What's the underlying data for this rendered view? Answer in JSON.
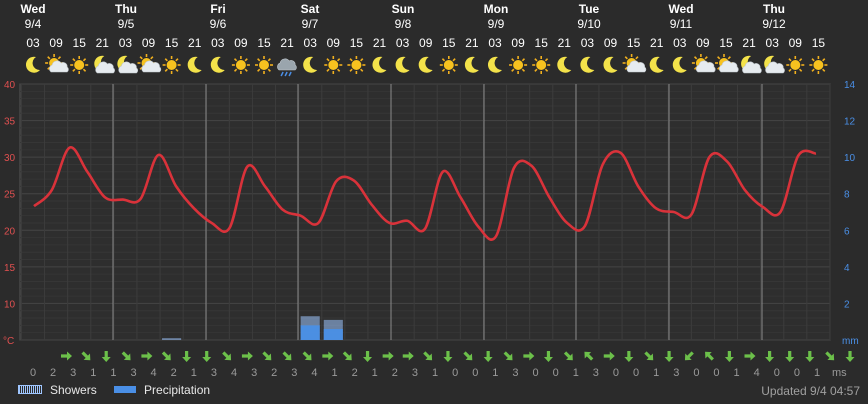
{
  "chart_data": {
    "type": "line",
    "days": [
      {
        "name": "Wed",
        "date": "9/4"
      },
      {
        "name": "Thu",
        "date": "9/5"
      },
      {
        "name": "Fri",
        "date": "9/6"
      },
      {
        "name": "Sat",
        "date": "9/7"
      },
      {
        "name": "Sun",
        "date": "9/8"
      },
      {
        "name": "Mon",
        "date": "9/9"
      },
      {
        "name": "Tue",
        "date": "9/10"
      },
      {
        "name": "Wed",
        "date": "9/11"
      },
      {
        "name": "Thu",
        "date": "9/12"
      }
    ],
    "hours": [
      "03",
      "09",
      "15",
      "21",
      "03",
      "09",
      "15",
      "21",
      "03",
      "09",
      "15",
      "21",
      "03",
      "09",
      "15",
      "21",
      "03",
      "09",
      "15",
      "21",
      "03",
      "09",
      "15",
      "21",
      "03",
      "09",
      "15",
      "21",
      "03",
      "09",
      "15",
      "21",
      "03",
      "09",
      "15"
    ],
    "icons": [
      "moon-icon",
      "sun-cloud-icon",
      "sun-icon",
      "moon-cloud-icon",
      "moon-cloud-icon",
      "sun-cloud-icon",
      "sun-icon",
      "moon-icon",
      "moon-icon",
      "sun-icon",
      "sun-icon",
      "rain-cloud-icon",
      "moon-icon",
      "sun-icon",
      "sun-icon",
      "moon-icon",
      "moon-icon",
      "moon-icon",
      "sun-icon",
      "moon-icon",
      "moon-icon",
      "sun-icon",
      "sun-icon",
      "moon-icon",
      "moon-icon",
      "moon-icon",
      "sun-cloud-icon",
      "moon-icon",
      "moon-icon",
      "sun-cloud-icon",
      "sun-cloud-icon",
      "moon-cloud-icon",
      "moon-cloud-icon",
      "sun-icon",
      "sun-icon"
    ],
    "temperature_c": [
      23.3,
      25.5,
      31.3,
      28.0,
      24.5,
      24.2,
      24.3,
      30.3,
      26.0,
      23.0,
      21.0,
      20.3,
      28.7,
      26.0,
      22.8,
      22.0,
      21.0,
      26.7,
      26.8,
      23.5,
      21.0,
      21.3,
      20.2,
      28.0,
      24.5,
      20.5,
      19.2,
      28.5,
      28.8,
      24.5,
      21.0,
      20.6,
      29.0,
      30.6,
      26.0,
      23.0,
      22.5,
      22.2,
      30.0,
      29.4,
      25.5,
      23.2,
      22.5,
      30.2,
      30.5
    ],
    "precipitation_mm": {
      "sat_03": 0.8,
      "sat_09": 0.6
    },
    "showers_mm": {
      "thu_15": 0.1,
      "sat_03": 1.3,
      "sat_09": 1.1
    },
    "wind_dirs": [
      "right",
      "down-right",
      "down",
      "down-right",
      "right",
      "down-right",
      "down",
      "down",
      "down-right",
      "right",
      "down-right",
      "down-right",
      "down-right",
      "right",
      "down-right",
      "down",
      "right",
      "right",
      "down-right",
      "down",
      "down-right",
      "down",
      "down-right",
      "right",
      "down",
      "down-right",
      "up-left",
      "right",
      "down",
      "down-right",
      "down",
      "down-left",
      "up-left",
      "down",
      "right",
      "down",
      "down",
      "down",
      "down-right",
      "down"
    ],
    "wind_speed": [
      0,
      2,
      3,
      1,
      1,
      3,
      4,
      2,
      1,
      3,
      4,
      3,
      2,
      3,
      4,
      1,
      2,
      1,
      2,
      3,
      1,
      0,
      0,
      1,
      3,
      0,
      0,
      1,
      3,
      0,
      0,
      1,
      3,
      0,
      0,
      1,
      4,
      0,
      0,
      1,
      3
    ],
    "y_left": {
      "unit": "°C",
      "ticks": [
        10,
        15,
        20,
        25,
        30,
        35,
        40
      ],
      "range": [
        5,
        40
      ]
    },
    "y_right": {
      "unit": "mm",
      "ticks": [
        2,
        4,
        6,
        8,
        10,
        12,
        14
      ],
      "range": [
        0,
        14
      ]
    },
    "wind_unit": "ms"
  },
  "legend": {
    "showers": "Showers",
    "precipitation": "Precipitation"
  },
  "updated": "Updated 9/4 04:57",
  "colors": {
    "temperature": "#d9323a",
    "precipitation": "#4a8fe6",
    "wind_arrow": "#6cc04a",
    "grid": "#3a3a3a",
    "day_line": "#8a8a8a",
    "left_axis": "#e05050",
    "right_axis": "#4a8fe6"
  }
}
